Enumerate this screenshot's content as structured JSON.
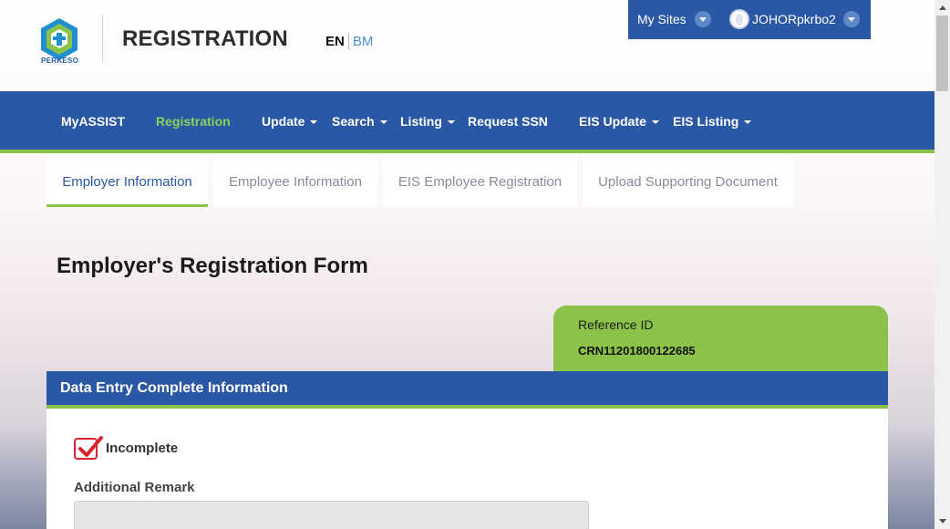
{
  "header": {
    "logo_text": "PERKESO",
    "title": "REGISTRATION",
    "lang_en": "EN",
    "lang_bm": "BM"
  },
  "topbar": {
    "my_sites": "My Sites",
    "username": "JOHORpkrbo2"
  },
  "nav": {
    "items": [
      {
        "label": "MyASSIST",
        "dropdown": false
      },
      {
        "label": "Registration",
        "dropdown": false,
        "active": true
      },
      {
        "label": "Update",
        "dropdown": true
      },
      {
        "label": "Search",
        "dropdown": true
      },
      {
        "label": "Listing",
        "dropdown": true
      },
      {
        "label": "Request SSN",
        "dropdown": false
      },
      {
        "label": "EIS Update",
        "dropdown": true
      },
      {
        "label": "EIS Listing",
        "dropdown": true
      }
    ]
  },
  "tabs": [
    {
      "label": "Employer Information",
      "active": true
    },
    {
      "label": "Employee Information"
    },
    {
      "label": "EIS Employee Registration"
    },
    {
      "label": "Upload Supporting Document"
    }
  ],
  "form": {
    "title": "Employer's Registration Form",
    "reference_label": "Reference ID",
    "reference_value": "CRN11201800122685",
    "section_title": "Data Entry Complete Information",
    "checkbox_label": "Incomplete",
    "checkbox_checked": true,
    "remark_label": "Additional Remark",
    "remark_value": ""
  },
  "colors": {
    "primary_blue": "#2a58a4",
    "accent_green": "#8bc34a",
    "active_nav_text": "#8dd05a",
    "checkbox_red": "#d9232d"
  }
}
